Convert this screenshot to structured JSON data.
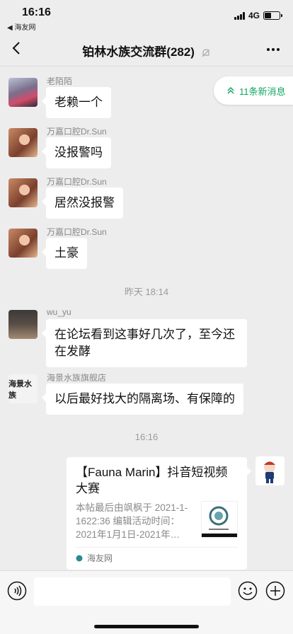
{
  "status_bar": {
    "time": "16:16",
    "back_app": "◀ 海友网",
    "network": "4G",
    "battery_level": 0.45
  },
  "nav": {
    "title": "铂林水族交流群(282)"
  },
  "new_messages_pill": {
    "label": "11条新消息",
    "accent": "#10a760"
  },
  "messages": [
    {
      "sender": "老陌陌",
      "text": "老赖一个"
    },
    {
      "sender": "万嘉口腔Dr.Sun",
      "text": "没报警吗"
    },
    {
      "sender": "万嘉口腔Dr.Sun",
      "text": "居然没报警"
    },
    {
      "sender": "万嘉口腔Dr.Sun",
      "text": "土豪"
    },
    {
      "sender": "wu_yu",
      "text_line1": "在论坛看到这事好几次了，至今还",
      "text_line2": "在发酵"
    },
    {
      "sender": "海景水族旗舰店",
      "avatar_text": "海景水族",
      "text": "以后最好找大的隔离场、有保障的"
    }
  ],
  "timestamps": [
    "昨天 18:14",
    "16:16"
  ],
  "shared_card": {
    "title_line1": "【Fauna Marin】抖音短视频",
    "title_line2": "大赛",
    "desc": "本帖最后由飒枫于 2021-1-1622:36 编辑活动时间：2021年1月1日-2021年…",
    "source": "海友网"
  }
}
